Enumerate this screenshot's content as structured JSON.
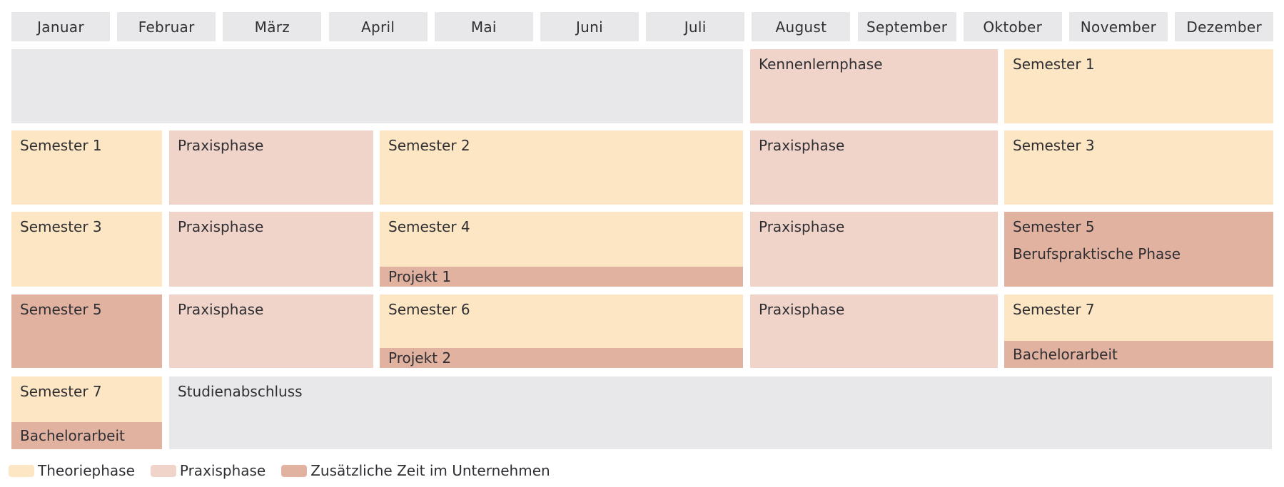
{
  "colors": {
    "theory": "#fde6c3",
    "praxis": "#f0d4c9",
    "extra": "#e2b2a1",
    "neutral": "#e8e8ea",
    "text": "#2f2f33"
  },
  "months": [
    "Januar",
    "Februar",
    "März",
    "April",
    "Mai",
    "Juni",
    "Juli",
    "August",
    "September",
    "Oktober",
    "November",
    "Dezember"
  ],
  "rows": [
    {
      "blocks": [
        {
          "type": "gray",
          "lines": []
        },
        {
          "type": "praxis",
          "lines": [
            "Kennenlernphase"
          ]
        },
        {
          "type": "theory",
          "lines": [
            "Semester 1"
          ]
        }
      ]
    },
    {
      "blocks": [
        {
          "type": "theory",
          "lines": [
            "Semester 1"
          ]
        },
        {
          "type": "praxis",
          "lines": [
            "Praxisphase"
          ]
        },
        {
          "type": "theory",
          "lines": [
            "Semester 2"
          ]
        },
        {
          "type": "praxis",
          "lines": [
            "Praxisphase"
          ]
        },
        {
          "type": "theory",
          "lines": [
            "Semester 3"
          ]
        }
      ]
    },
    {
      "blocks": [
        {
          "type": "theory",
          "lines": [
            "Semester 3"
          ]
        },
        {
          "type": "praxis",
          "lines": [
            "Praxisphase"
          ]
        },
        {
          "type": "theory",
          "lines": [
            "Semester 4"
          ],
          "band": "Projekt 1"
        },
        {
          "type": "praxis",
          "lines": [
            "Praxisphase"
          ]
        },
        {
          "type": "extra",
          "lines": [
            "Semester 5",
            "Berufspraktische Phase"
          ]
        }
      ]
    },
    {
      "blocks": [
        {
          "type": "extra",
          "lines": [
            "Semester 5"
          ]
        },
        {
          "type": "praxis",
          "lines": [
            "Praxisphase"
          ]
        },
        {
          "type": "theory",
          "lines": [
            "Semester 6"
          ],
          "band": "Projekt 2"
        },
        {
          "type": "praxis",
          "lines": [
            "Praxisphase"
          ]
        },
        {
          "type": "theory",
          "lines": [
            "Semester 7"
          ],
          "band": "Bachelorarbeit"
        }
      ]
    },
    {
      "blocks": [
        {
          "type": "theory",
          "lines": [
            "Semester 7"
          ],
          "band": "Bachelorarbeit"
        },
        {
          "type": "gray",
          "lines": [
            "Studienabschluss"
          ]
        }
      ]
    }
  ],
  "legend": [
    {
      "type": "theory",
      "label": "Theoriephase"
    },
    {
      "type": "praxis",
      "label": "Praxisphase"
    },
    {
      "type": "extra",
      "label": "Zusätzliche Zeit im Unternehmen"
    }
  ]
}
